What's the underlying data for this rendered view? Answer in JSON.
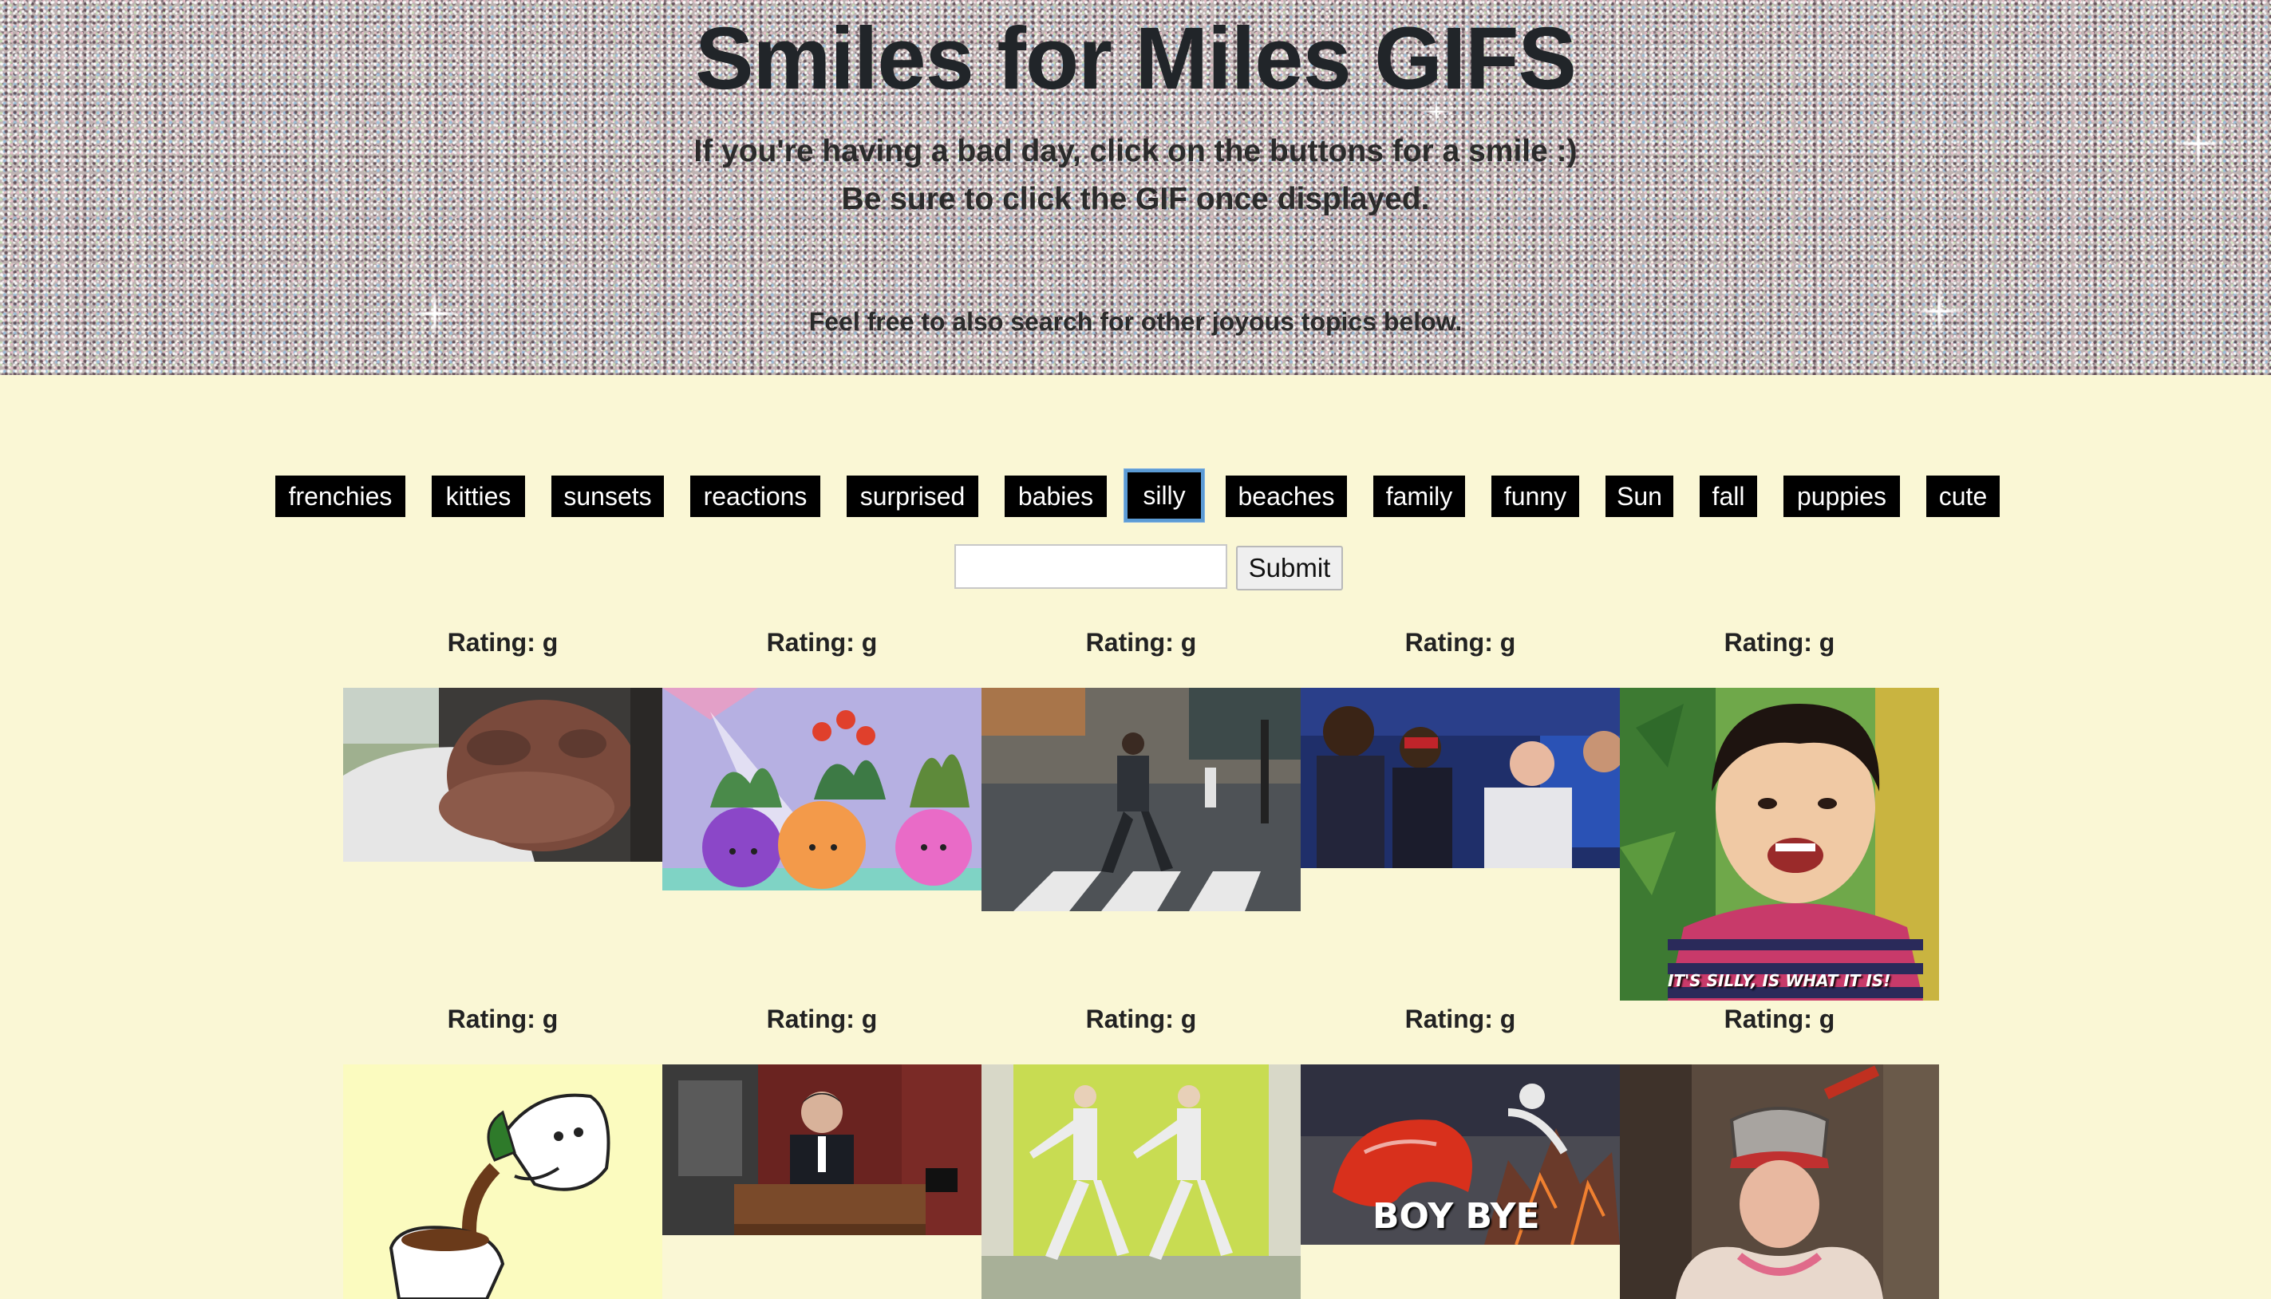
{
  "header": {
    "title": "Smiles for Miles GIFS",
    "subtitle_line1": "If you're having a bad day, click on the buttons for a smile :)",
    "subtitle_line2": "Be sure to click the GIF once displayed.",
    "subtitle_line3": "Feel free to also search for other joyous topics below."
  },
  "topics": [
    "frenchies",
    "kitties",
    "sunsets",
    "reactions",
    "surprised",
    "babies",
    "silly",
    "beaches",
    "family",
    "funny",
    "Sun",
    "fall",
    "puppies",
    "cute"
  ],
  "active_topic": "silly",
  "search": {
    "value": "",
    "placeholder": "",
    "submit_label": "Submit"
  },
  "gifs": [
    {
      "rating_label": "Rating: g",
      "subject": "dog-face-car-window"
    },
    {
      "rating_label": "Rating: g",
      "subject": "watering-smiling-plants"
    },
    {
      "rating_label": "Rating: g",
      "subject": "man-walking-crosswalk"
    },
    {
      "rating_label": "Rating: g",
      "subject": "crowd-reaction"
    },
    {
      "rating_label": "Rating: g",
      "subject": "silly-kid",
      "caption": "IT'S SILLY, IS WHAT IT IS!"
    },
    {
      "rating_label": "Rating: g",
      "subject": "coffee-pot-pouring"
    },
    {
      "rating_label": "Rating: g",
      "subject": "man-at-desk"
    },
    {
      "rating_label": "Rating: g",
      "subject": "dancing-men"
    },
    {
      "rating_label": "Rating: g",
      "subject": "boy-bye",
      "caption": "BOY BYE"
    },
    {
      "rating_label": "Rating: g",
      "subject": "pot-on-head"
    }
  ],
  "colors": {
    "background": "#faf7d5",
    "button_bg": "#000000",
    "button_text": "#ffffff",
    "active_outline": "#5b9bd5"
  }
}
